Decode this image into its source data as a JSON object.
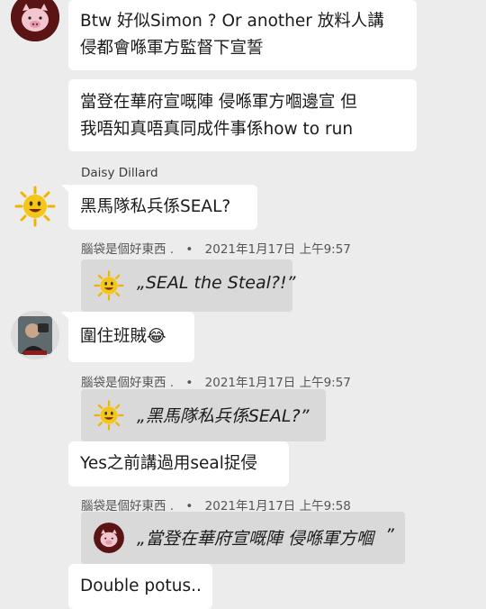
{
  "messages": [
    {
      "lines": [
        "Btw 好似Simon ? Or another 放料人講",
        "侵都會喺軍方監督下宣誓"
      ]
    },
    {
      "lines": [
        "當登在華府宣嘅陣 侵喺軍方嗰邊宣 但",
        "我唔知真唔真同成件事係how to run"
      ]
    },
    {
      "sender": "Daisy Dillard",
      "lines": [
        "黑馬隊私兵係SEAL?"
      ]
    },
    {
      "lines": [
        "圍住班賊😂"
      ]
    },
    {
      "lines": [
        "Yes之前講過用seal捉侵"
      ]
    },
    {
      "lines": [
        "Double potus.."
      ]
    }
  ],
  "reply_meta": [
    {
      "author": "腦袋是個好東西 .",
      "sep": "•",
      "timestamp": "2021年1月17日 上午9:57"
    },
    {
      "author": "腦袋是個好東西 .",
      "sep": "•",
      "timestamp": "2021年1月17日 上午9:57"
    },
    {
      "author": "腦袋是個好東西 .",
      "sep": "•",
      "timestamp": "2021年1月17日 上午9:58"
    }
  ],
  "quotes": [
    {
      "text": "„SEAL the Steal?!”",
      "icon": "sun-emoji-icon"
    },
    {
      "text": "„黑馬隊私兵係SEAL?”",
      "icon": "sun-emoji-icon"
    },
    {
      "text": "„當登在華府宣嘅陣 侵喺軍方嗰",
      "text_end": "”",
      "icon": "pig-avatar-icon"
    }
  ],
  "colors": {
    "background": "#ececec",
    "bubble": "#ffffff",
    "quote_bg": "#d9d9d9",
    "sun": "#f5c518",
    "pig_bg": "#5a1414"
  }
}
